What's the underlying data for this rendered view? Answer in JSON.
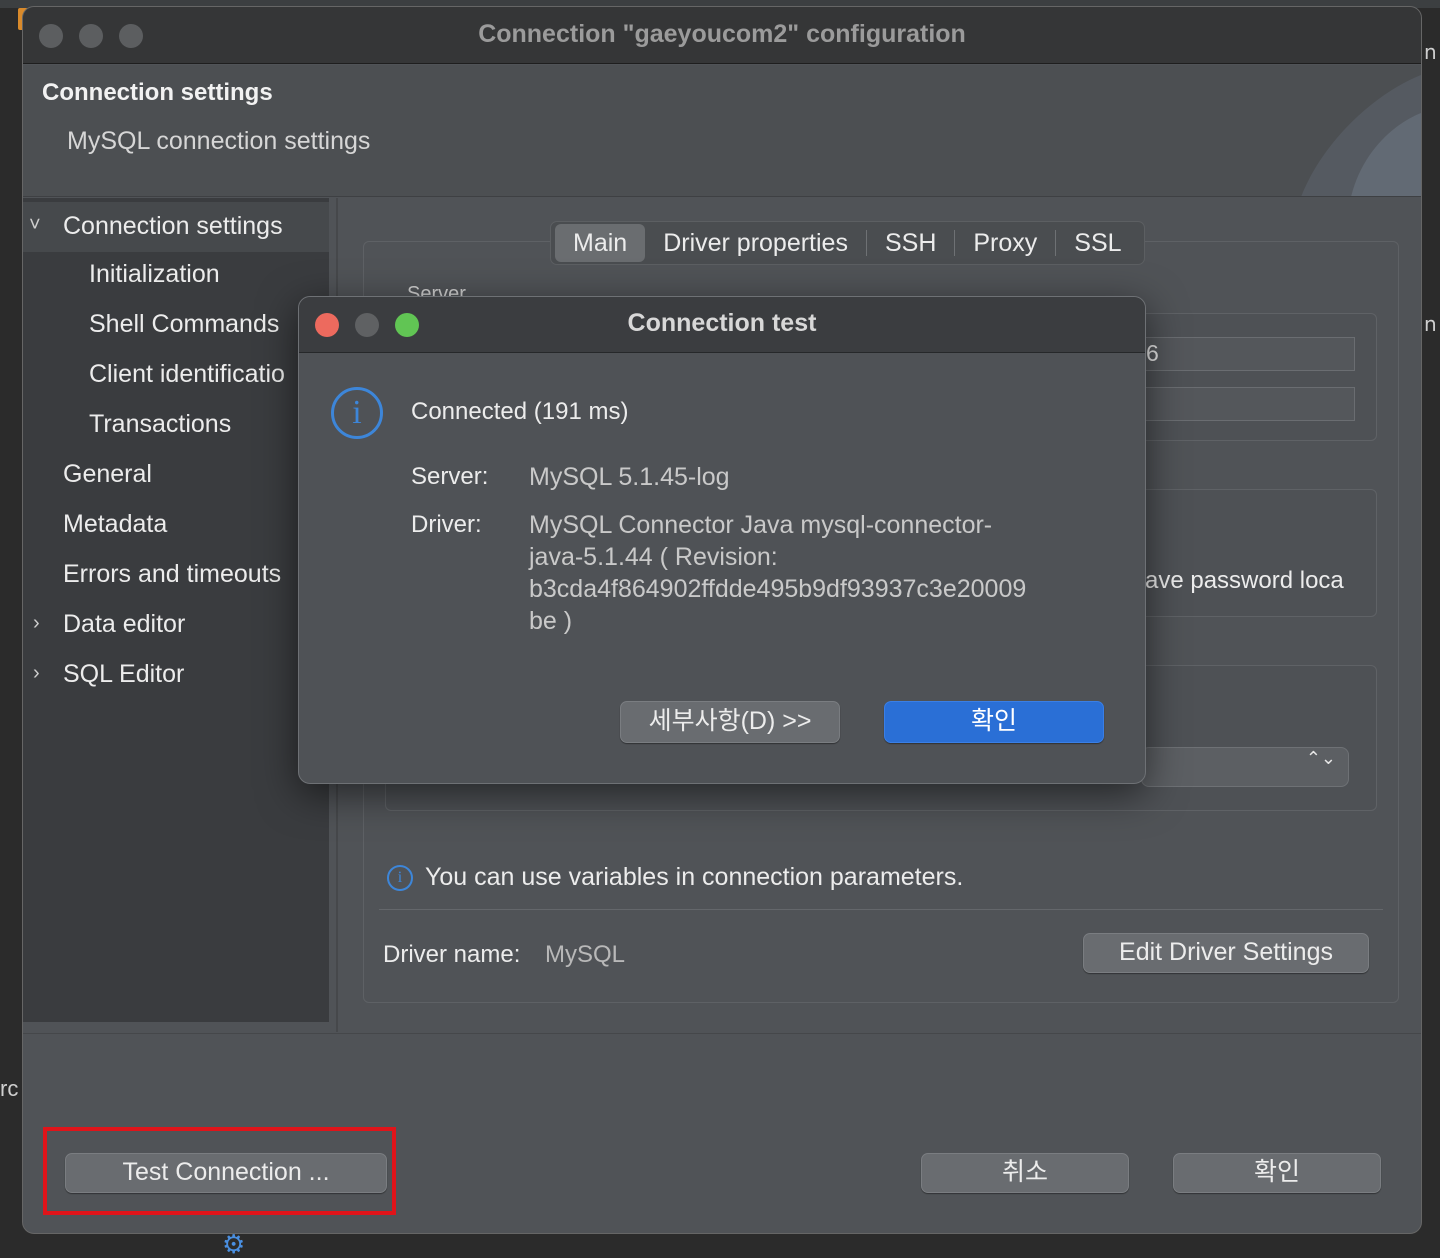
{
  "window": {
    "title": "Connection \"gaeyoucom2\" configuration",
    "header_title": "Connection settings",
    "header_subtitle": "MySQL connection settings"
  },
  "sidebar": {
    "items": [
      {
        "label": "Connection settings",
        "expander": "˅"
      },
      {
        "label": "Initialization"
      },
      {
        "label": "Shell Commands"
      },
      {
        "label": "Client identificatio"
      },
      {
        "label": "Transactions"
      },
      {
        "label": "General"
      },
      {
        "label": "Metadata"
      },
      {
        "label": "Errors and timeouts"
      },
      {
        "label": "Data editor",
        "expander": "›"
      },
      {
        "label": "SQL Editor",
        "expander": "›"
      }
    ]
  },
  "tabs": [
    {
      "label": "Main"
    },
    {
      "label": "Driver properties"
    },
    {
      "label": "SSH"
    },
    {
      "label": "Proxy"
    },
    {
      "label": "SSL"
    }
  ],
  "main": {
    "server_group_partial": "Server",
    "host_field_partial": "6",
    "save_password_partial": "ave password loca",
    "select_arrows": "⌃⌄",
    "variables_info": "You can use variables in connection parameters.",
    "driver_name_label": "Driver name:",
    "driver_name_value": "MySQL",
    "edit_driver_button": "Edit Driver Settings"
  },
  "footer": {
    "test_connection": "Test Connection ...",
    "cancel": "취소",
    "ok": "확인"
  },
  "dialog": {
    "title": "Connection test",
    "status": "Connected (191 ms)",
    "server_label": "Server:",
    "server_value": "MySQL 5.1.45-log",
    "driver_label": "Driver:",
    "driver_value_lines": [
      "MySQL Connector Java mysql-connector-",
      "java-5.1.44 ( Revision:",
      "b3cda4f864902ffdde495b9df93937c3e20009",
      "be )"
    ],
    "details_button": "세부사항(D) >>",
    "ok_button": "확인"
  },
  "background": {
    "right_fragment_1": "n",
    "right_fragment_2": "n",
    "left_fragment": "rc"
  },
  "colors": {
    "accent_blue": "#2a6fd6",
    "info_blue": "#3d86d9",
    "highlight_red": "#e0141a",
    "traffic_red": "#ed6a5e",
    "traffic_green": "#61c554"
  }
}
